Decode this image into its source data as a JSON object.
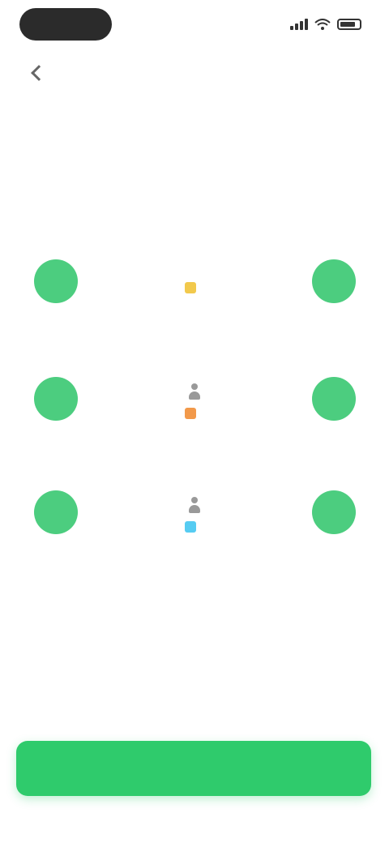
{
  "status_bar": {
    "time": "",
    "icons": [
      "signal-icon",
      "wifi-icon",
      "battery-icon"
    ]
  },
  "header": {
    "title": "",
    "back_icon": "back-arrow-icon"
  },
  "rows": [
    {
      "title": "",
      "label": "",
      "icon_color": "#f2c94c"
    },
    {
      "title": "",
      "label": "",
      "icon_color": "#f2994a"
    },
    {
      "title": "",
      "label": "",
      "icon_color": "#56ccf2"
    }
  ],
  "primary_button": {
    "label": ""
  },
  "colors": {
    "accent": "#2fcb6c",
    "dot": "#4ccd7f",
    "status_pill": "#2b2b2b"
  }
}
